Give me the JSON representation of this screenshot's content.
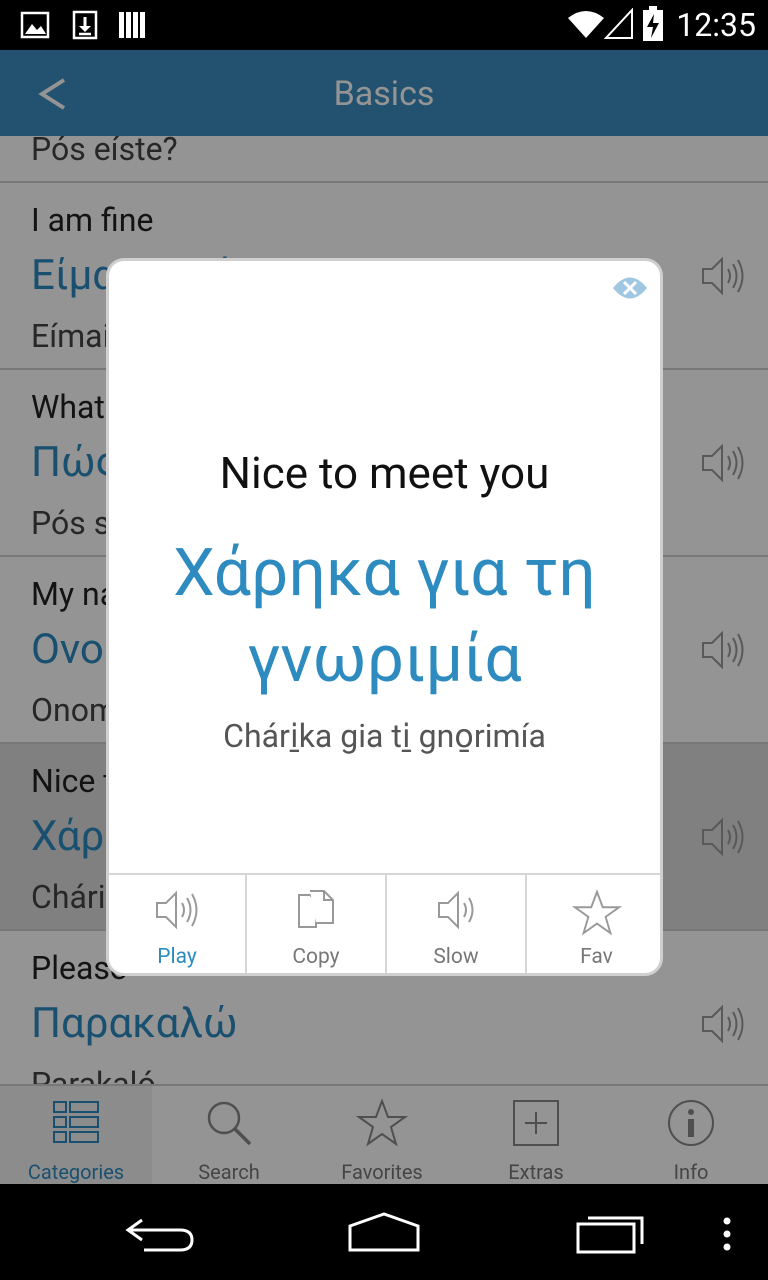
{
  "status": {
    "time": "12:35"
  },
  "appbar": {
    "title": "Basics",
    "back": "<"
  },
  "list": [
    {
      "en": "",
      "gr": "",
      "tr": "Pós eíste?"
    },
    {
      "en": "I am fine",
      "gr": "Είμαι καλά",
      "tr": "Eímai kalá"
    },
    {
      "en": "What is your name?",
      "gr": "Πώς σε λένε;",
      "tr": "Pós se léne?"
    },
    {
      "en": "My name is ...",
      "gr": "Ονομάζομαι ...",
      "tr": "Onomázomai ..."
    },
    {
      "en": "Nice to meet you",
      "gr": "Χάρηκα για τη γνωριμία",
      "tr": "Chárika gia ti gnorimía"
    },
    {
      "en": "Please",
      "gr": "Παρακαλώ",
      "tr": "Parakaló"
    }
  ],
  "dialog": {
    "english": "Nice to meet you",
    "greek": "Χάρηκα για τη γνωριμία",
    "translit": "Chári̱ka gia ti̱ gno̱rimía",
    "actions": {
      "play": "Play",
      "copy": "Copy",
      "slow": "Slow",
      "fav": "Fav"
    }
  },
  "tabs": {
    "categories": "Categories",
    "search": "Search",
    "favorites": "Favorites",
    "extras": "Extras",
    "info": "Info"
  },
  "colors": {
    "accent": "#2e8bc0",
    "appbar": "#3b8ec0"
  }
}
